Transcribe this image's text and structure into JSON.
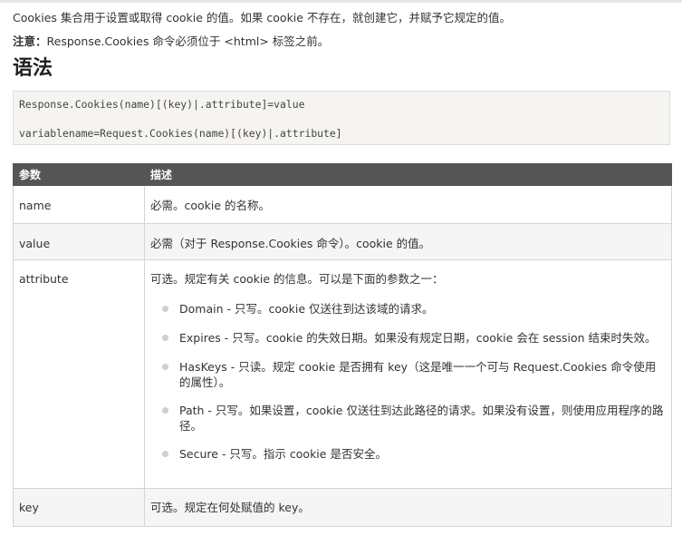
{
  "intro": {
    "text": "Cookies 集合用于设置或取得 cookie 的值。如果 cookie 不存在，就创建它，并赋予它规定的值。"
  },
  "note": {
    "label": "注意：",
    "text": "Response.Cookies 命令必须位于 <html> 标签之前。"
  },
  "syntax": {
    "heading": "语法",
    "lines": [
      "Response.Cookies(name)[(key)|.attribute]=value",
      "variablename=Request.Cookies(name)[(key)|.attribute]"
    ]
  },
  "table": {
    "headers": [
      "参数",
      "描述"
    ],
    "rows": [
      {
        "param": "name",
        "desc": "必需。cookie 的名称。"
      },
      {
        "param": "value",
        "desc": "必需（对于 Response.Cookies 命令）。cookie 的值。"
      },
      {
        "param": "attribute",
        "desc": "可选。规定有关 cookie 的信息。可以是下面的参数之一：",
        "options": [
          "Domain - 只写。cookie 仅送往到达该域的请求。",
          "Expires - 只写。cookie 的失效日期。如果没有规定日期，cookie 会在 session 结束时失效。",
          "HasKeys - 只读。规定 cookie 是否拥有 key（这是唯一一个可与 Request.Cookies 命令使用的属性）。",
          "Path - 只写。如果设置，cookie 仅送往到达此路径的请求。如果没有设置，则使用应用程序的路径。",
          "Secure - 只写。指示 cookie 是否安全。"
        ]
      },
      {
        "param": "key",
        "desc": "可选。规定在何处赋值的 key。"
      }
    ]
  }
}
